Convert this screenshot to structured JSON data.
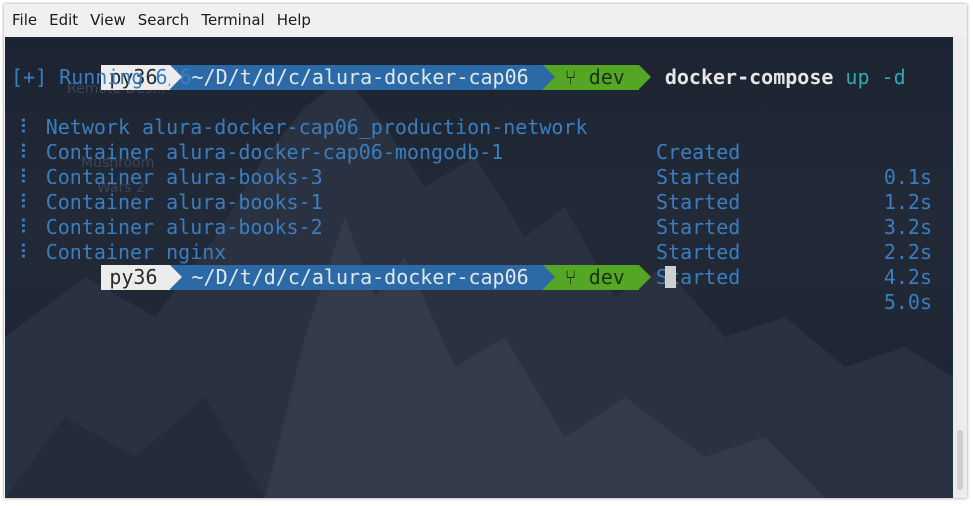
{
  "menubar": {
    "items": [
      "File",
      "Edit",
      "View",
      "Search",
      "Terminal",
      "Help"
    ]
  },
  "prompt": {
    "env": "py36",
    "path": "~/D/t/d/c/alura-docker-cap06",
    "branch_icon": "⑂",
    "branch": "dev"
  },
  "command": {
    "name": "docker-compose",
    "args": "up -d"
  },
  "status_line": "[+] Running 6/6",
  "rows": [
    {
      "bullet": "⠇",
      "name": "Network alura-docker-cap06_production-network",
      "status": "Created",
      "time": "0.1s"
    },
    {
      "bullet": "⠇",
      "name": "Container alura-docker-cap06-mongodb-1",
      "status": "Started",
      "time": "1.2s"
    },
    {
      "bullet": "⠇",
      "name": "Container alura-books-3",
      "status": "Started",
      "time": "3.2s"
    },
    {
      "bullet": "⠇",
      "name": "Container alura-books-1",
      "status": "Started",
      "time": "2.2s"
    },
    {
      "bullet": "⠇",
      "name": "Container alura-books-2",
      "status": "Started",
      "time": "4.2s"
    },
    {
      "bullet": "⠇",
      "name": "Container nginx",
      "status": "Started",
      "time": "5.0s"
    }
  ],
  "desktop_ghost": [
    "Remote Des...",
    "Mushroom",
    "Wars 2"
  ],
  "colors": {
    "prompt_env": "#ececec",
    "prompt_dir": "#2c6aa7",
    "prompt_git": "#55a625",
    "output_text": "#3b7ec0",
    "command_args": "#2fa9b8"
  }
}
